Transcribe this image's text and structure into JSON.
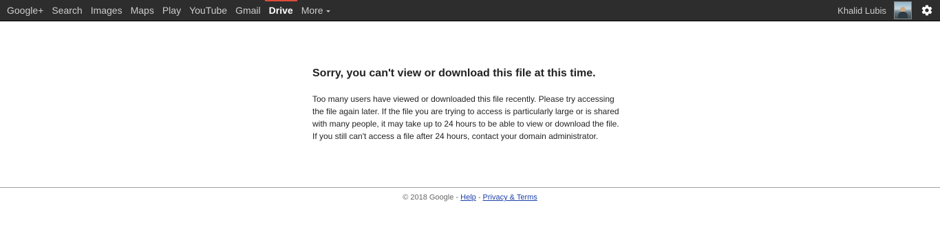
{
  "topbar": {
    "nav": [
      {
        "label": "Google+"
      },
      {
        "label": "Search"
      },
      {
        "label": "Images"
      },
      {
        "label": "Maps"
      },
      {
        "label": "Play"
      },
      {
        "label": "YouTube"
      },
      {
        "label": "Gmail"
      },
      {
        "label": "Drive",
        "active": true
      },
      {
        "label": "More"
      }
    ],
    "username": "Khalid Lubis",
    "avatar_icon": "user-avatar",
    "settings_icon": "gear-icon",
    "colors": {
      "background": "#2d2d2d",
      "active_indicator": "#dd4b39"
    }
  },
  "main": {
    "title": "Sorry, you can't view or download this file at this time.",
    "message": "Too many users have viewed or downloaded this file recently. Please try accessing the file again later. If the file you are trying to access is particularly large or is shared with many people, it may take up to 24 hours to be able to view or download the file. If you still can't access a file after 24 hours, contact your domain administrator."
  },
  "footer": {
    "copyright": "© 2018 Google",
    "separator": " - ",
    "help_label": "Help",
    "privacy_label": "Privacy & Terms",
    "link_color": "#1a3fa8"
  }
}
